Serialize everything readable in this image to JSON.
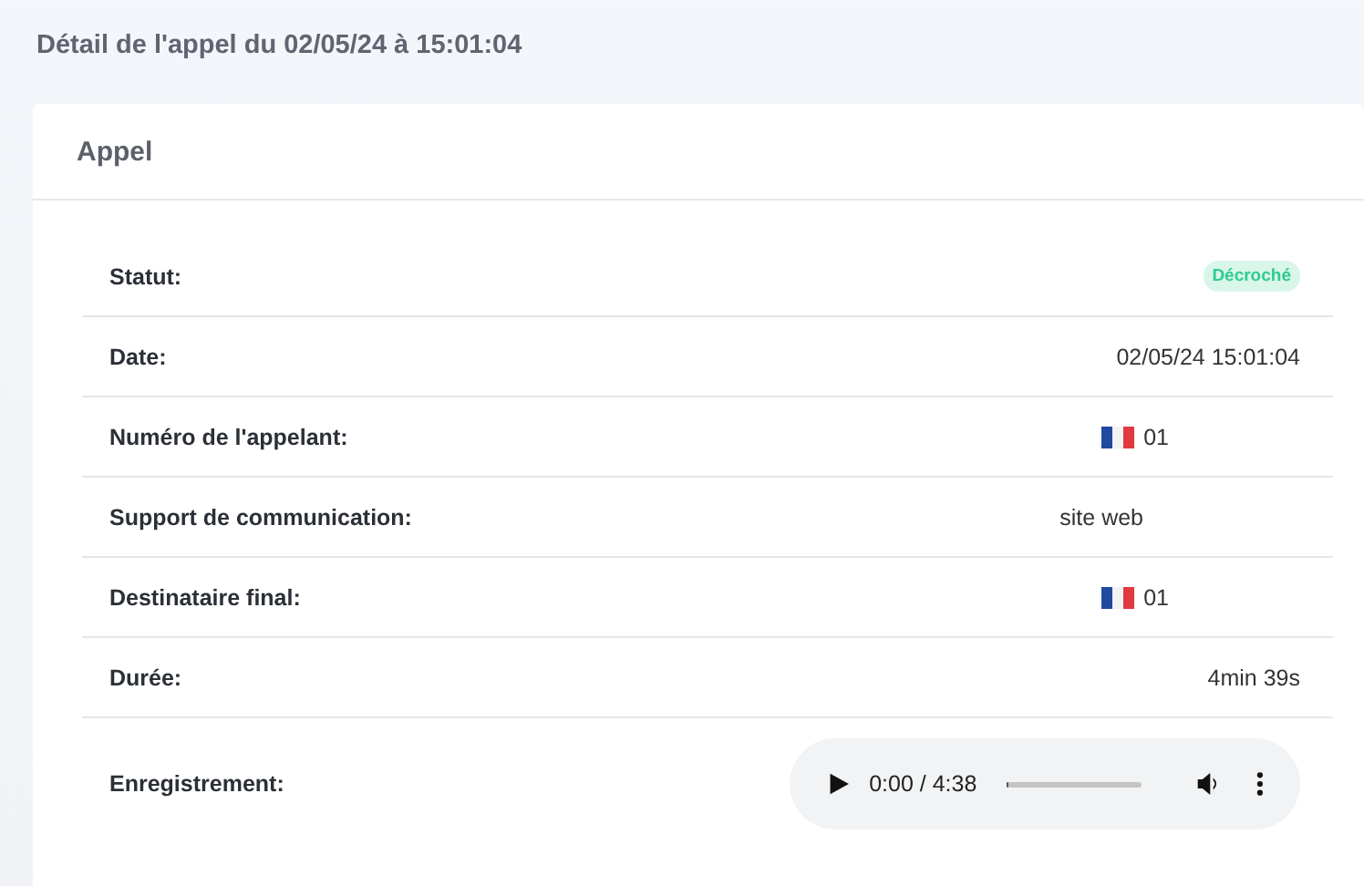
{
  "page_title": "Détail de l'appel du 02/05/24 à 15:01:04",
  "card": {
    "title": "Appel",
    "rows": [
      {
        "label": "Statut:",
        "kind": "badge",
        "value": "Décroché",
        "color": "#2ecc8f"
      },
      {
        "label": "Date:",
        "kind": "text",
        "value": "02/05/24 15:01:04"
      },
      {
        "label": "Numéro de l'appelant:",
        "kind": "phone",
        "value": "01"
      },
      {
        "label": "Support de communication:",
        "kind": "channel",
        "value": "site web"
      },
      {
        "label": "Destinataire final:",
        "kind": "phone",
        "value": "01"
      },
      {
        "label": "Durée:",
        "kind": "text",
        "value": "4min 39s"
      },
      {
        "label": "Enregistrement:",
        "kind": "audio",
        "time": "0:00 / 4:38",
        "level": 0.01
      }
    ]
  }
}
